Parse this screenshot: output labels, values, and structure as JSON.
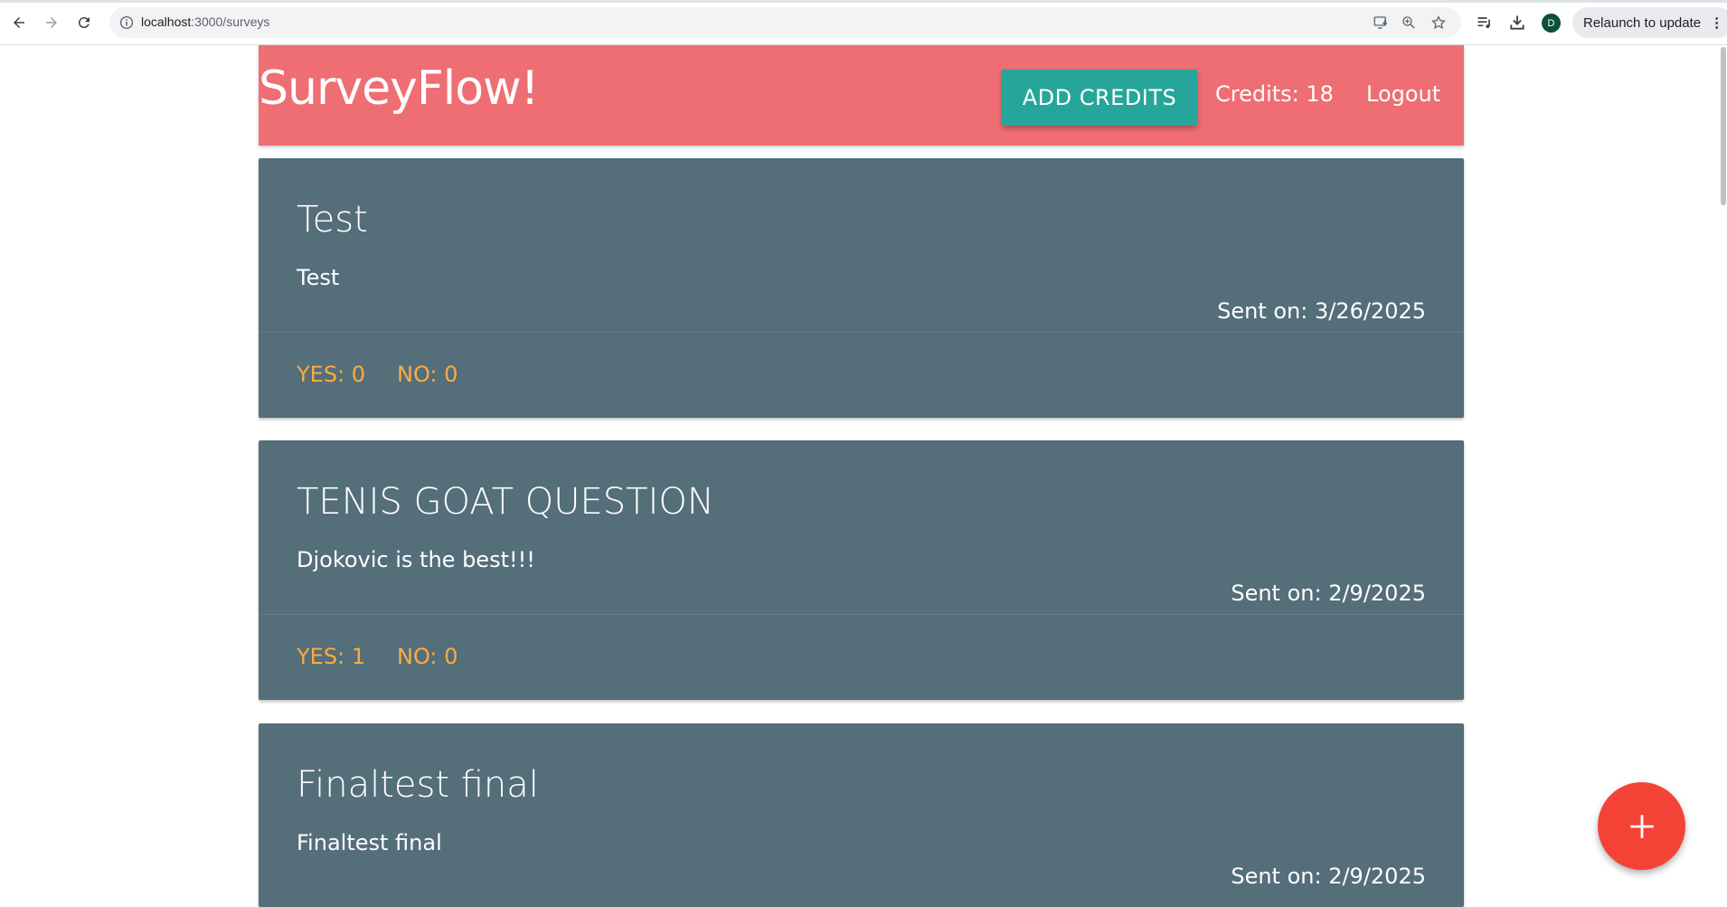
{
  "browser": {
    "url_host": "localhost",
    "url_path": ":3000/surveys",
    "profile_initial": "D",
    "relaunch_label": "Relaunch to update",
    "relaunch_menu": "⋮"
  },
  "header": {
    "brand": "SurveyFlow!",
    "add_credits_label": "ADD CREDITS",
    "credits_text": "Credits: 18",
    "logout_label": "Logout"
  },
  "surveys": [
    {
      "title": "Test",
      "body": "Test",
      "sent": "Sent on: 3/26/2025",
      "yes": "YES: 0",
      "no": "NO: 0"
    },
    {
      "title": "TENIS GOAT QUESTION",
      "body": "Djokovic is the best!!!",
      "sent": "Sent on: 2/9/2025",
      "yes": "YES: 1",
      "no": "NO: 0"
    },
    {
      "title": "Finaltest final",
      "body": "Finaltest final",
      "sent": "Sent on: 2/9/2025"
    }
  ],
  "fab": {
    "icon": "plus-icon"
  },
  "colors": {
    "header": "#ee6e73",
    "accent_button": "#26a69a",
    "card": "#546e7a",
    "card_action": "#ffab40",
    "fab": "#f44336"
  }
}
